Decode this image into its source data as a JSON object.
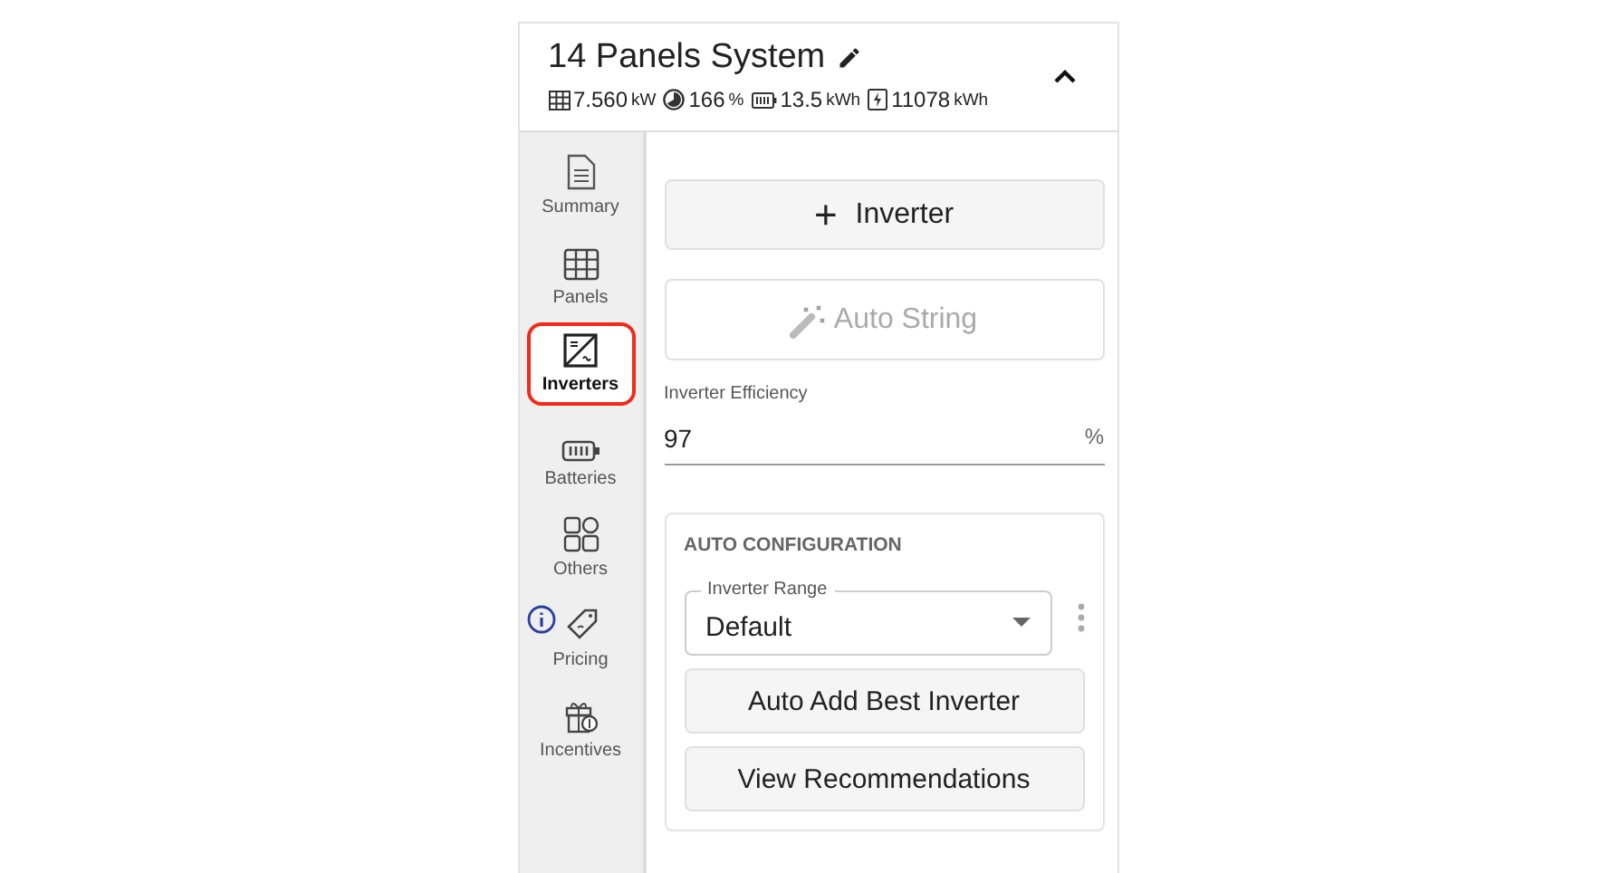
{
  "header": {
    "title": "14 Panels System",
    "stats": [
      {
        "kind": "grid",
        "value": "7.560",
        "unit": "kW"
      },
      {
        "kind": "offset",
        "value": "166",
        "unit": "%"
      },
      {
        "kind": "battery",
        "value": "13.5",
        "unit": "kWh"
      },
      {
        "kind": "energy",
        "value": "11078",
        "unit": "kWh"
      }
    ],
    "expanded": true
  },
  "sidebar": {
    "items": [
      {
        "kind": "summary",
        "label": "Summary",
        "selected": false,
        "info": false
      },
      {
        "kind": "panels",
        "label": "Panels",
        "selected": false,
        "info": false
      },
      {
        "kind": "inverters",
        "label": "Inverters",
        "selected": true,
        "info": false
      },
      {
        "kind": "batteries",
        "label": "Batteries",
        "selected": false,
        "info": false
      },
      {
        "kind": "others",
        "label": "Others",
        "selected": false,
        "info": false
      },
      {
        "kind": "pricing",
        "label": "Pricing",
        "selected": false,
        "info": true
      },
      {
        "kind": "incentives",
        "label": "Incentives",
        "selected": false,
        "info": false
      }
    ]
  },
  "add_button": {
    "icon": "+",
    "label": "Inverter"
  },
  "auto_string_button": {
    "label": "Auto String",
    "disabled": true
  },
  "efficiency": {
    "label": "Inverter Efficiency",
    "value": "97",
    "unit": "%"
  },
  "auto_configuration": {
    "title": "AUTO CONFIGURATION",
    "range": {
      "label": "Inverter Range",
      "value": "Default"
    },
    "buttons": [
      "Auto Add Best Inverter",
      "View Recommendations"
    ]
  }
}
